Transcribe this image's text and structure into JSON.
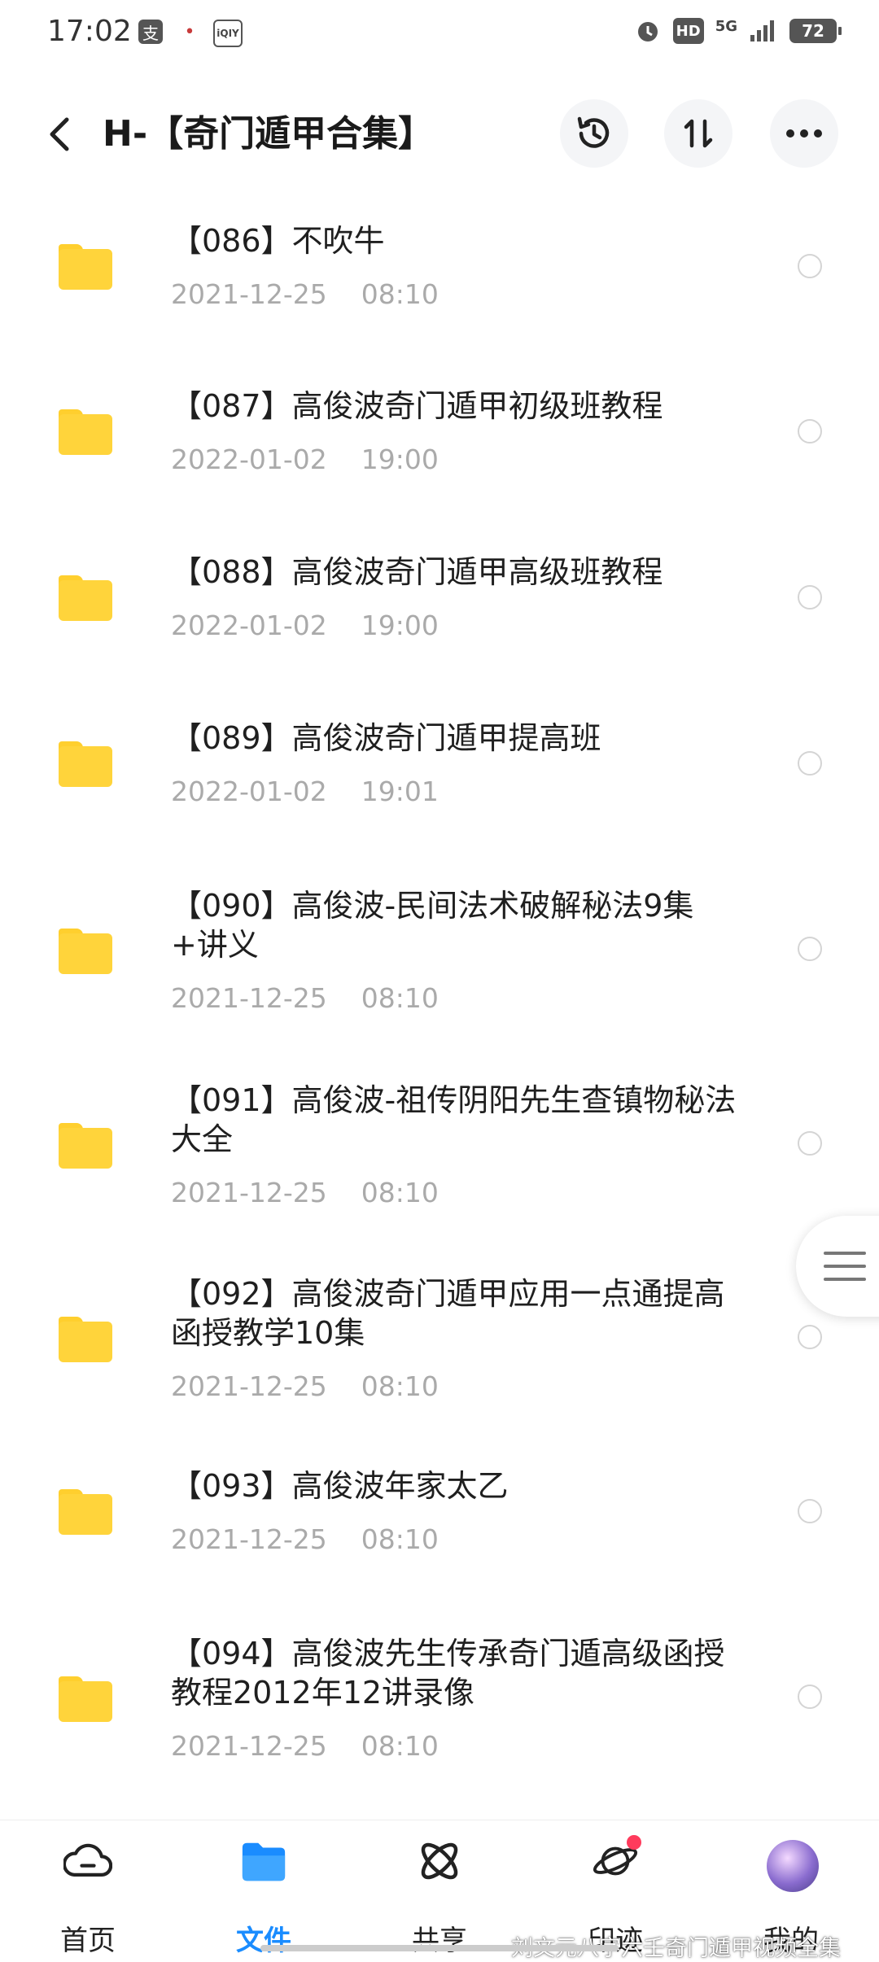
{
  "status_bar": {
    "time": "17:02",
    "app_icons": [
      "支",
      "•",
      "iQIY"
    ],
    "right_icons": [
      "alarm-icon",
      "HD",
      "5G",
      "signal-icon"
    ],
    "battery": "72"
  },
  "header": {
    "title": "H-【奇门遁甲合集】",
    "actions": [
      "history-icon",
      "sort-icon",
      "more-icon"
    ]
  },
  "files": [
    {
      "name": "【086】不吹牛",
      "date": "2021-12-25    08:10"
    },
    {
      "name": "【087】高俊波奇门遁甲初级班教程",
      "date": "2022-01-02    19:00"
    },
    {
      "name": "【088】高俊波奇门遁甲高级班教程",
      "date": "2022-01-02    19:00"
    },
    {
      "name": "【089】高俊波奇门遁甲提高班",
      "date": "2022-01-02    19:01"
    },
    {
      "name": "【090】高俊波-民间法术破解秘法9集+讲义",
      "date": "2021-12-25    08:10"
    },
    {
      "name": "【091】高俊波-祖传阴阳先生查镇物秘法大全",
      "date": "2021-12-25    08:10"
    },
    {
      "name": "【092】高俊波奇门遁甲应用一点通提高函授教学10集",
      "date": "2021-12-25    08:10"
    },
    {
      "name": "【093】高俊波年家太乙",
      "date": "2021-12-25    08:10"
    },
    {
      "name": "【094】高俊波先生传承奇门遁高级函授教程2012年12讲录像",
      "date": "2021-12-25    08:10"
    }
  ],
  "bottom_nav": {
    "items": [
      {
        "label": "首页",
        "icon": "cloud-home-icon"
      },
      {
        "label": "文件",
        "icon": "folder-icon",
        "active": true
      },
      {
        "label": "共享",
        "icon": "atom-share-icon"
      },
      {
        "label": "印迹",
        "icon": "planet-icon",
        "badge": true
      },
      {
        "label": "我的",
        "icon": "avatar"
      }
    ]
  },
  "watermark": "刘文元八字六壬奇门遁甲视频全集",
  "colors": {
    "accent": "#1a8cff",
    "folder": "#ffd43b",
    "badge": "#ff3b5c",
    "date_text": "#aaaaaa"
  }
}
